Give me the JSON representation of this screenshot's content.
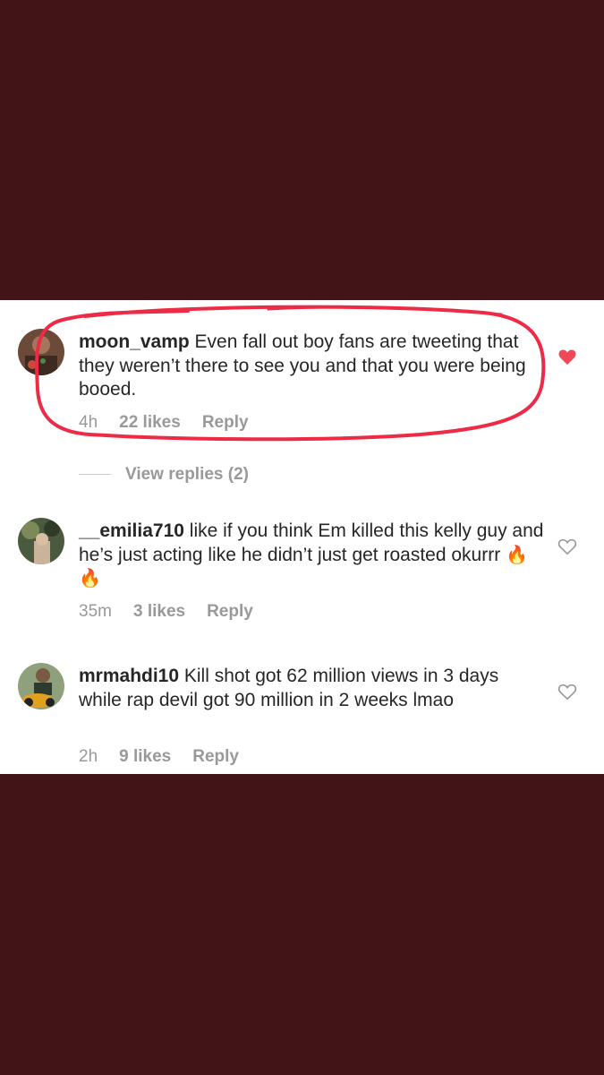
{
  "comments": [
    {
      "username": "moon_vamp",
      "text": " Even fall out boy fans are tweeting that they weren’t there to see you and that you were being booed.",
      "time": "4h",
      "likes": "22 likes",
      "reply": "Reply",
      "liked": true
    },
    {
      "username": "__emilia710",
      "text": " like if you think Em killed this kelly guy and he’s just acting like he didn’t just get roasted okurrr ",
      "emoji": "🔥 🔥",
      "time": "35m",
      "likes": "3 likes",
      "reply": "Reply",
      "liked": false
    },
    {
      "username": "mrmahdi10",
      "text": " Kill shot got 62 million views in 3 days while rap devil got 90 million in 2 weeks lmao",
      "time": "2h",
      "likes": "9 likes",
      "reply": "Reply",
      "liked": false
    }
  ],
  "view_replies": "View replies (2)",
  "colors": {
    "background": "#421417",
    "annotation": "#ee2b47",
    "liked_heart": "#ed4956",
    "meta": "#999999"
  }
}
